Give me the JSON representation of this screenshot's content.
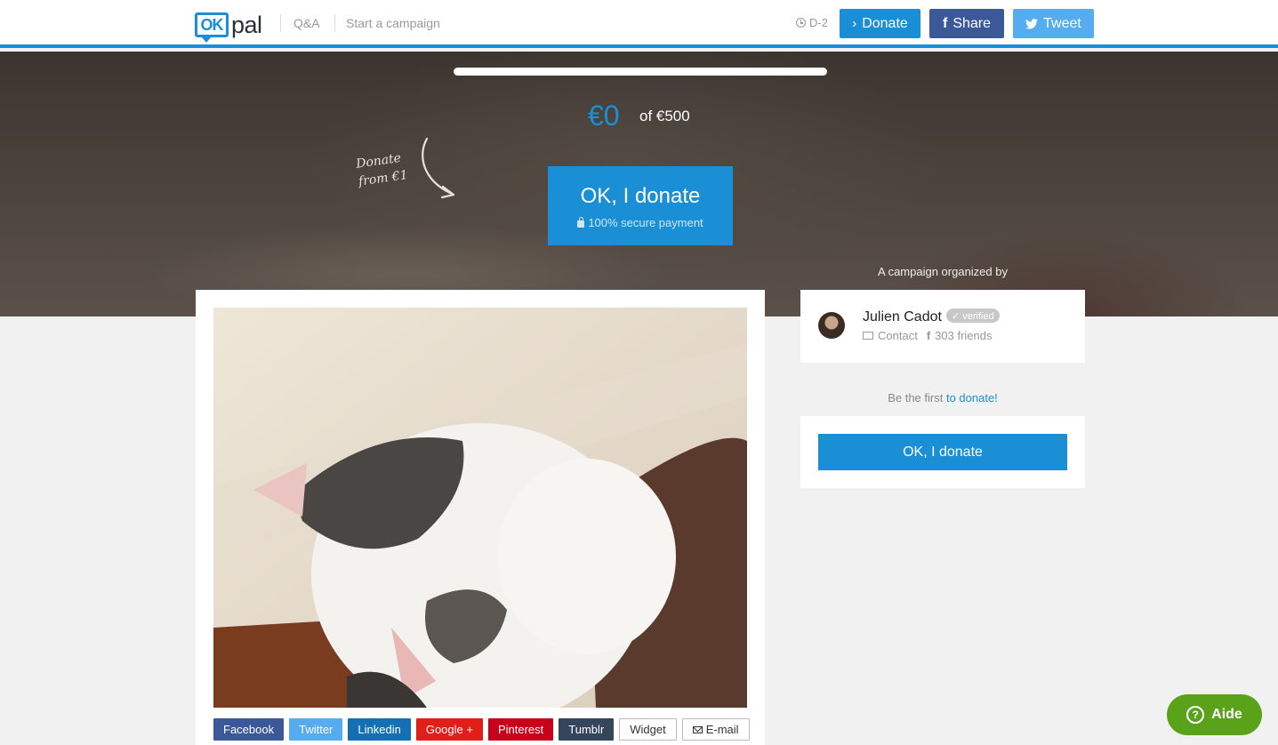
{
  "nav": {
    "logo_ok": "OK",
    "logo_pal": "pal",
    "qa": "Q&A",
    "start_campaign": "Start a campaign",
    "deadline": "D-2",
    "donate": "Donate",
    "share": "Share",
    "tweet": "Tweet"
  },
  "hero": {
    "raised": "€0",
    "goal": "of €500",
    "progress_percent": 0,
    "hint_line1": "Donate",
    "hint_line2": "from €1",
    "donate_label": "OK, I donate",
    "secure_label": "100% secure payment",
    "organized_by": "A campaign organized by"
  },
  "organizer": {
    "name": "Julien Cadot",
    "verified": "✓ verified",
    "contact": "Contact",
    "friends": "303 friends"
  },
  "sidebar": {
    "first_prefix": "Be the first ",
    "first_link": "to donate!",
    "donate_label": "OK, I donate"
  },
  "share": {
    "facebook": "Facebook",
    "twitter": "Twitter",
    "linkedin": "Linkedin",
    "googleplus": "Google +",
    "pinterest": "Pinterest",
    "tumblr": "Tumblr",
    "widget": "Widget",
    "email": "E-mail"
  },
  "help": {
    "label": "Aide"
  },
  "colors": {
    "brand_blue": "#1a8fd6",
    "facebook": "#3b5998",
    "twitter": "#55acee",
    "help_green": "#5ba21b"
  }
}
